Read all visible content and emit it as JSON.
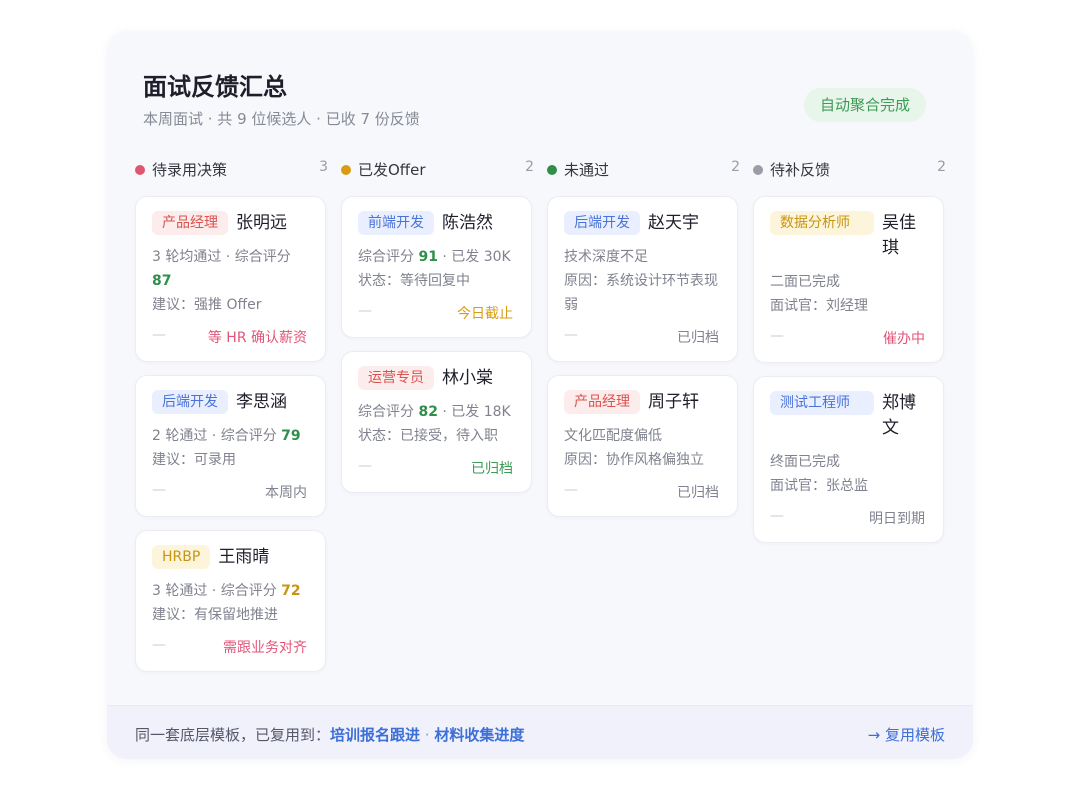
{
  "header": {
    "title": "面试反馈汇总",
    "subtitle": "本周面试 · 共 9 位候选人 · 已收 7 份反馈",
    "badge": "自动聚合完成"
  },
  "columns": [
    {
      "title": "待录用决策",
      "count": "3",
      "dot_color": "#e0566f",
      "cards": [
        {
          "tag": "产品经理",
          "name": "张明远",
          "line1_pre": "3 轮均通过 · 综合评分 ",
          "score": "87",
          "line2": "建议：强推 Offer",
          "dash": "—",
          "status": "等 HR 确认薪资"
        },
        {
          "tag": "后端开发",
          "name": "李思涵",
          "line1_pre": "2 轮通过 · 综合评分 ",
          "score": "79",
          "line2": "建议：可录用",
          "dash": "—",
          "status": "本周内"
        },
        {
          "tag": "HRBP",
          "name": "王雨晴",
          "line1_pre": "3 轮通过 · 综合评分 ",
          "score": "72",
          "line2": "建议：有保留地推进",
          "dash": "—",
          "status": "需跟业务对齐"
        }
      ]
    },
    {
      "title": "已发Offer",
      "count": "2",
      "dot_color": "#d89c14",
      "cards": [
        {
          "tag": "前端开发",
          "name": "陈浩然",
          "line1_pre": "综合评分 ",
          "score": "91",
          "line1_post": " · 已发 30K",
          "line2": "状态：等待回复中",
          "dash": "—",
          "status": "今日截止"
        },
        {
          "tag": "运营专员",
          "name": "林小棠",
          "line1_pre": "综合评分 ",
          "score": "82",
          "line1_post": " · 已发 18K",
          "line2": "状态：已接受，待入职",
          "dash": "—",
          "status": "已归档"
        }
      ]
    },
    {
      "title": "未通过",
      "count": "2",
      "dot_color": "#2f8f4a",
      "cards": [
        {
          "tag": "后端开发",
          "name": "赵天宇",
          "line1": "技术深度不足",
          "line2": "原因：系统设计环节表现弱",
          "dash": "—",
          "status": "已归档"
        },
        {
          "tag": "产品经理",
          "name": "周子轩",
          "line1": "文化匹配度偏低",
          "line2": "原因：协作风格偏独立",
          "dash": "—",
          "status": "已归档"
        }
      ]
    },
    {
      "title": "待补反馈",
      "count": "2",
      "dot_color": "#9a9ca6",
      "cards": [
        {
          "tag": "数据分析师",
          "name": "吴佳琪",
          "line1": "二面已完成",
          "line2": "面试官：刘经理",
          "dash": "—",
          "status": "催办中"
        },
        {
          "tag": "测试工程师",
          "name": "郑博文",
          "line1": "终面已完成",
          "line2": "面试官：张总监",
          "dash": "—",
          "status": "明日到期"
        }
      ]
    }
  ],
  "footer": {
    "prefix": "同一套底层模板，已复用到：",
    "link1": "培训报名跟进",
    "sep": " · ",
    "link2": "材料收集进度",
    "reuse": "→ 复用模板"
  },
  "colors": {
    "accent_blue": "#3d6fd8",
    "status_pink": "#e2567a",
    "status_green": "#3e9a57",
    "status_orange": "#d89c14"
  }
}
